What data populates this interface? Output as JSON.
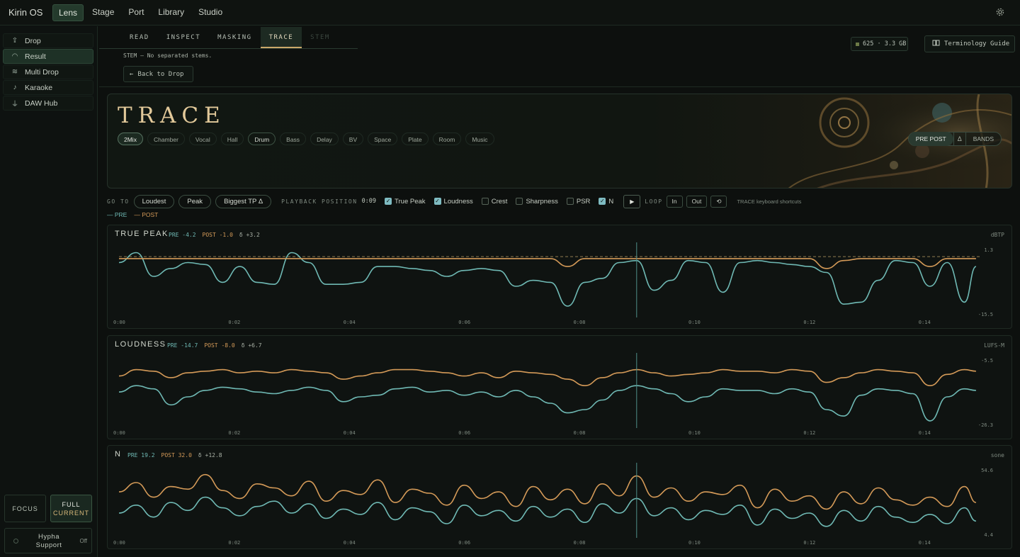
{
  "app": {
    "title": "Kirin OS"
  },
  "nav": {
    "tabs": [
      "Lens",
      "Stage",
      "Port",
      "Library",
      "Studio"
    ],
    "active": "Lens"
  },
  "sidebar": {
    "items": [
      {
        "label": "Drop",
        "icon": "upload-icon"
      },
      {
        "label": "Result",
        "icon": "gauge-icon"
      },
      {
        "label": "Multi Drop",
        "icon": "layers-icon"
      },
      {
        "label": "Karaoke",
        "icon": "microphone-icon"
      },
      {
        "label": "DAW Hub",
        "icon": "plug-icon"
      }
    ],
    "active": "Result",
    "focus_label": "FOCUS",
    "full_label": "FULL",
    "full_sub": "CURRENT",
    "hypha_label": "Hypha Support",
    "hypha_state": "Off"
  },
  "subtabs": {
    "items": [
      "READ",
      "INSPECT",
      "MASKING",
      "TRACE",
      "STEM"
    ],
    "active": "TRACE",
    "disabled": "STEM"
  },
  "stem_note": "STEM — No separated stems.",
  "back_label": "Back to Drop",
  "storage": {
    "text": "625 · 3.3 GB"
  },
  "terminology_label": "Terminology Guide",
  "hero": {
    "title": "TRACE",
    "chips": [
      "2Mix",
      "Chamber",
      "Vocal",
      "Hall",
      "Drum",
      "Bass",
      "Delay",
      "BV",
      "Space",
      "Plate",
      "Room",
      "Music"
    ],
    "chip_selected": "2Mix",
    "chip_highlight": "Drum",
    "modes": {
      "left": "PRE POST",
      "icon": "delta-icon",
      "right": "BANDS"
    }
  },
  "controls": {
    "goto_label": "GO TO",
    "goto_buttons": [
      "Loudest",
      "Peak",
      "Biggest TP Δ"
    ],
    "playback_label": "PLAYBACK POSITION",
    "playback_value": "0:09",
    "checkboxes": [
      {
        "label": "True Peak",
        "checked": true
      },
      {
        "label": "Loudness",
        "checked": true
      },
      {
        "label": "Crest",
        "checked": false
      },
      {
        "label": "Sharpness",
        "checked": false
      },
      {
        "label": "PSR",
        "checked": false
      },
      {
        "label": "N",
        "checked": true
      }
    ],
    "loop_label": "LOOP",
    "loop_in": "In",
    "loop_out": "Out",
    "loop_reset_icon": "reset-icon",
    "shortcuts_label": "TRACE keyboard shortcuts"
  },
  "legend": {
    "pre": "— PRE",
    "post": "— POST"
  },
  "colors": {
    "pre": "#6fb9b4",
    "post": "#d49a58",
    "accent": "#c9a86a"
  },
  "time_ticks": [
    "0:00",
    "0:02",
    "0:04",
    "0:06",
    "0:08",
    "0:10",
    "0:12",
    "0:14"
  ],
  "playhead_time": 9.0,
  "duration": 15,
  "chart_data": [
    {
      "type": "line",
      "title": "TRUE PEAK",
      "stats": {
        "pre": "PRE -4.2",
        "post": "POST -1.0",
        "delta": "δ +3.2"
      },
      "unit": "dBTP",
      "ylim": [
        -15.5,
        1.3
      ],
      "ymax_label": "1.3",
      "ymin_label": "-15.5",
      "threshold": -0.5,
      "x": [
        0,
        0.3,
        0.6,
        0.9,
        1.2,
        1.5,
        1.8,
        2.1,
        2.4,
        2.7,
        3.0,
        3.3,
        3.6,
        3.9,
        4.2,
        4.5,
        4.8,
        5.1,
        5.4,
        5.7,
        6.0,
        6.3,
        6.6,
        6.9,
        7.2,
        7.5,
        7.8,
        8.1,
        8.4,
        8.7,
        9.0,
        9.3,
        9.6,
        9.9,
        10.2,
        10.5,
        10.8,
        11.1,
        11.4,
        11.7,
        12.0,
        12.3,
        12.6,
        12.9,
        13.2,
        13.5,
        13.8,
        14.1,
        14.4,
        14.7,
        14.9
      ],
      "series": [
        {
          "name": "PRE",
          "values": [
            -2.0,
            0.5,
            -5.5,
            -3.5,
            -2.0,
            -2.5,
            -7.0,
            -3.0,
            -7.0,
            -7.5,
            0.5,
            -2.0,
            -7.5,
            -7.5,
            -7.0,
            -3.0,
            -3.0,
            -3.5,
            -4.0,
            -5.5,
            -4.0,
            -3.5,
            -4.0,
            -8.0,
            -6.5,
            -7.0,
            -13.0,
            -7.0,
            -6.0,
            -2.0,
            -1.5,
            -9.0,
            -6.5,
            -1.5,
            -2.0,
            -9.5,
            -2.0,
            -1.5,
            -2.0,
            -2.5,
            -3.0,
            -4.5,
            -12.5,
            -12.0,
            -6.5,
            -1.5,
            -2.0,
            -8.0,
            -2.0,
            -12.0,
            -3.0
          ]
        },
        {
          "name": "POST",
          "values": [
            -1.0,
            -1.0,
            -1.0,
            -1.0,
            -1.0,
            -1.0,
            -1.0,
            -1.0,
            -1.0,
            -1.0,
            -1.0,
            -1.0,
            -1.0,
            -1.0,
            -1.0,
            -1.0,
            -1.0,
            -1.0,
            -1.0,
            -1.0,
            -1.0,
            -1.0,
            -1.0,
            -1.0,
            -1.0,
            -1.0,
            -3.0,
            -1.0,
            -1.0,
            -1.0,
            -1.0,
            -1.0,
            -1.0,
            -1.0,
            -1.0,
            -1.0,
            -1.0,
            -1.0,
            -1.0,
            -1.0,
            -1.0,
            -3.5,
            -1.5,
            -1.0,
            -1.0,
            -1.0,
            -1.0,
            -3.0,
            -1.0,
            -1.0,
            -1.0
          ]
        }
      ]
    },
    {
      "type": "line",
      "title": "LOUDNESS",
      "stats": {
        "pre": "PRE -14.7",
        "post": "POST -8.0",
        "delta": "δ +6.7"
      },
      "unit": "LUFS-M",
      "ylim": [
        -26.3,
        -5.5
      ],
      "ymax_label": "-5.5",
      "ymin_label": "-26.3",
      "x": [
        0,
        0.3,
        0.6,
        0.9,
        1.2,
        1.5,
        1.8,
        2.1,
        2.4,
        2.7,
        3.0,
        3.3,
        3.6,
        3.9,
        4.2,
        4.5,
        4.8,
        5.1,
        5.4,
        5.7,
        6.0,
        6.3,
        6.6,
        6.9,
        7.2,
        7.5,
        7.8,
        8.1,
        8.4,
        8.7,
        9.0,
        9.3,
        9.6,
        9.9,
        10.2,
        10.5,
        10.8,
        11.1,
        11.4,
        11.7,
        12.0,
        12.3,
        12.6,
        12.9,
        13.2,
        13.5,
        13.8,
        14.1,
        14.4,
        14.7,
        14.9
      ],
      "series": [
        {
          "name": "PRE",
          "values": [
            -15.5,
            -13.5,
            -14.5,
            -19.5,
            -17.0,
            -15.0,
            -14.0,
            -14.5,
            -15.5,
            -16.0,
            -15.0,
            -14.0,
            -15.0,
            -18.5,
            -17.0,
            -16.5,
            -14.5,
            -14.0,
            -15.5,
            -15.0,
            -16.5,
            -15.5,
            -17.0,
            -15.0,
            -17.0,
            -19.0,
            -22.0,
            -21.0,
            -18.0,
            -15.0,
            -13.5,
            -14.5,
            -16.0,
            -18.5,
            -17.0,
            -14.5,
            -15.0,
            -15.0,
            -16.0,
            -14.5,
            -15.5,
            -21.0,
            -23.0,
            -16.5,
            -14.5,
            -15.0,
            -16.0,
            -24.5,
            -17.0,
            -14.5,
            -15.0
          ]
        },
        {
          "name": "POST",
          "values": [
            -10.5,
            -8.5,
            -9.0,
            -11.0,
            -9.5,
            -9.0,
            -8.5,
            -9.5,
            -9.0,
            -9.5,
            -8.5,
            -9.0,
            -9.5,
            -11.5,
            -10.5,
            -9.5,
            -8.5,
            -8.5,
            -9.0,
            -9.5,
            -10.5,
            -9.5,
            -11.0,
            -9.0,
            -9.5,
            -10.0,
            -11.5,
            -13.5,
            -11.0,
            -9.5,
            -8.5,
            -9.5,
            -10.5,
            -10.0,
            -9.5,
            -8.5,
            -9.0,
            -9.0,
            -9.5,
            -8.5,
            -9.0,
            -12.5,
            -11.0,
            -9.5,
            -8.5,
            -9.0,
            -9.5,
            -13.5,
            -10.0,
            -8.5,
            -9.0
          ]
        }
      ]
    },
    {
      "type": "line",
      "title": "N",
      "stats": {
        "pre": "PRE 19.2",
        "post": "POST 32.0",
        "delta": "δ +12.8"
      },
      "unit": "sone",
      "ylim": [
        4.4,
        54.6
      ],
      "ymax_label": "54.6",
      "ymin_label": "4.4",
      "x": [
        0,
        0.3,
        0.6,
        0.9,
        1.2,
        1.5,
        1.8,
        2.1,
        2.4,
        2.7,
        3.0,
        3.3,
        3.6,
        3.9,
        4.2,
        4.5,
        4.8,
        5.1,
        5.4,
        5.7,
        6.0,
        6.3,
        6.6,
        6.9,
        7.2,
        7.5,
        7.8,
        8.1,
        8.4,
        8.7,
        9.0,
        9.3,
        9.6,
        9.9,
        10.2,
        10.5,
        10.8,
        11.1,
        11.4,
        11.7,
        12.0,
        12.3,
        12.6,
        12.9,
        13.2,
        13.5,
        13.8,
        14.1,
        14.4,
        14.7,
        14.9
      ],
      "series": [
        {
          "name": "PRE",
          "values": [
            22,
            28,
            19,
            30,
            24,
            34,
            26,
            20,
            27,
            31,
            22,
            29,
            18,
            25,
            21,
            30,
            17,
            26,
            23,
            14,
            28,
            20,
            24,
            16,
            27,
            19,
            25,
            15,
            29,
            22,
            33,
            20,
            26,
            17,
            24,
            21,
            28,
            13,
            25,
            18,
            22,
            12,
            24,
            16,
            27,
            19,
            15,
            21,
            14,
            26,
            16
          ]
        },
        {
          "name": "POST",
          "values": [
            38,
            45,
            34,
            42,
            40,
            51,
            39,
            33,
            44,
            41,
            35,
            46,
            31,
            39,
            36,
            47,
            30,
            40,
            37,
            28,
            43,
            33,
            38,
            27,
            42,
            32,
            40,
            29,
            44,
            35,
            50,
            34,
            41,
            31,
            38,
            36,
            43,
            26,
            40,
            31,
            35,
            25,
            38,
            29,
            41,
            32,
            28,
            34,
            27,
            42,
            30
          ]
        }
      ]
    }
  ]
}
